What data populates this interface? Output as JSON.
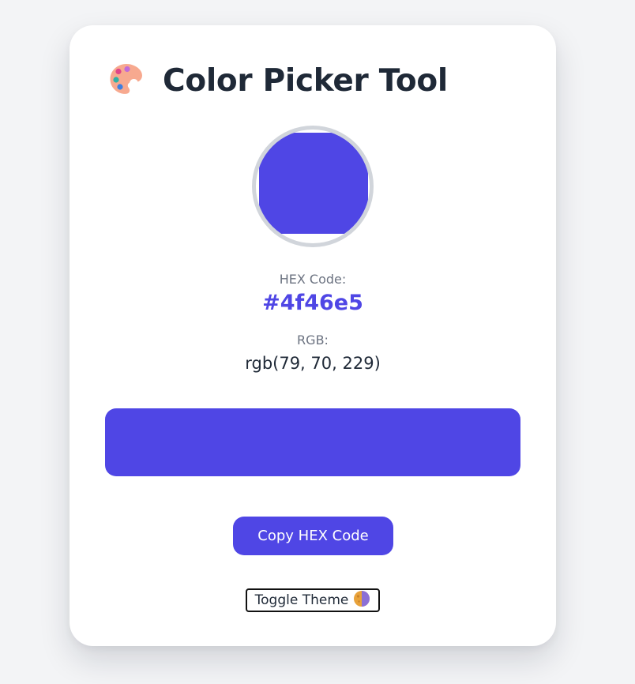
{
  "app": {
    "title": "Color Picker Tool"
  },
  "colors": {
    "selected": "#4f46e5",
    "background": "#f3f4f6",
    "card": "#ffffff",
    "title": "#1f2937",
    "muted": "#6b7280",
    "ring": "#d1d5db"
  },
  "icons": {
    "header": "artist-palette-icon",
    "theme": "moon-icon"
  },
  "picker": {
    "hex_label": "HEX Code:",
    "hex_value": "#4f46e5",
    "rgb_label": "RGB:",
    "rgb_value": "rgb(79, 70, 229)"
  },
  "actions": {
    "copy_label": "Copy HEX Code",
    "theme_label": "Toggle Theme"
  }
}
